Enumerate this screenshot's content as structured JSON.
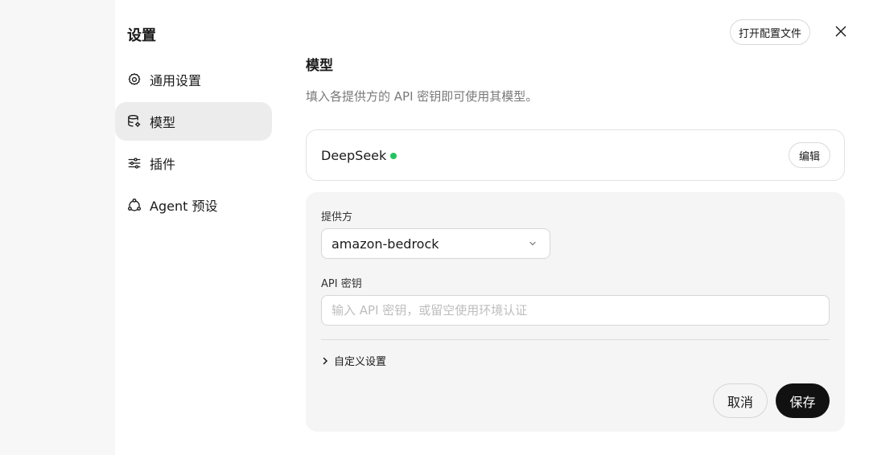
{
  "sidebar": {
    "title": "设置",
    "items": [
      {
        "label": "通用设置",
        "icon": "gear-icon",
        "active": false
      },
      {
        "label": "模型",
        "icon": "database-gear-icon",
        "active": true
      },
      {
        "label": "插件",
        "icon": "sliders-icon",
        "active": false
      },
      {
        "label": "Agent 预设",
        "icon": "agent-nodes-icon",
        "active": false
      }
    ]
  },
  "header": {
    "open_config_label": "打开配置文件",
    "close_icon": "close-icon"
  },
  "main": {
    "title": "模型",
    "description": "填入各提供方的 API 密钥即可使用其模型。",
    "provider_card": {
      "name": "DeepSeek",
      "status_color": "#22c55e",
      "edit_label": "编辑"
    },
    "form": {
      "provider_label": "提供方",
      "provider_value": "amazon-bedrock",
      "api_key_label": "API 密钥",
      "api_key_placeholder": "输入 API 密钥，或留空使用环境认证",
      "api_key_value": "",
      "custom_settings_label": "自定义设置",
      "cancel_label": "取消",
      "save_label": "保存"
    }
  },
  "colors": {
    "accent": "#111111",
    "active_nav_bg": "#ececec",
    "panel_bg": "#f5f5f5"
  }
}
